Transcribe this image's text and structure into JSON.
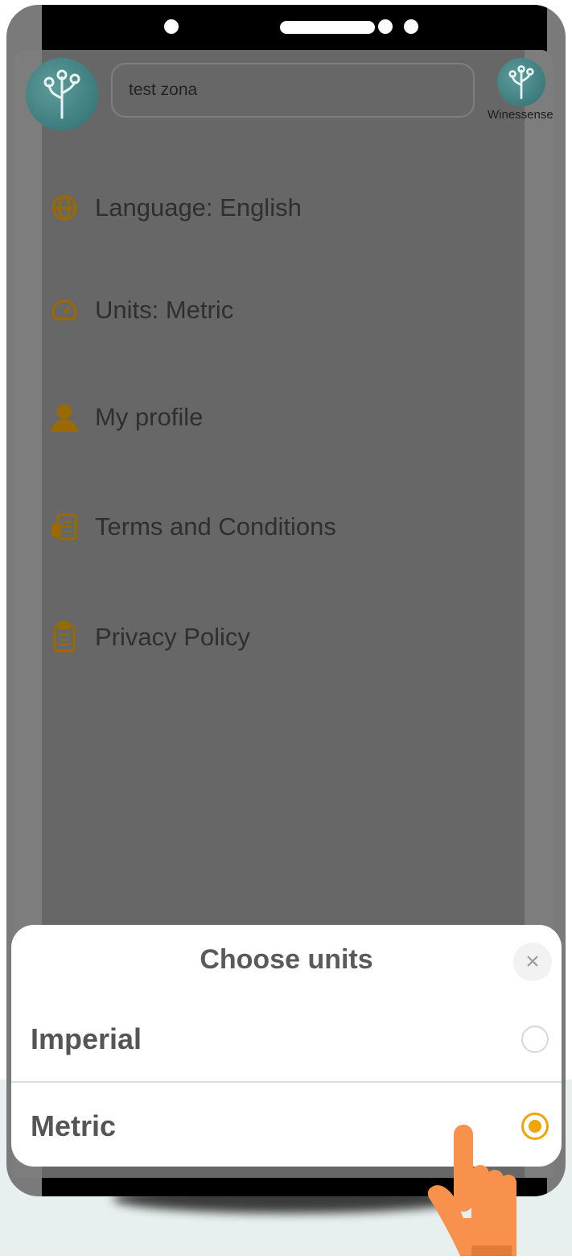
{
  "search": {
    "value": "test zona"
  },
  "brand": {
    "label": "Winessense"
  },
  "menu": {
    "items": [
      {
        "label": "Language: English",
        "icon": "globe-icon"
      },
      {
        "label": "Units: Metric",
        "icon": "gauge-icon"
      },
      {
        "label": "My profile",
        "icon": "person-icon"
      },
      {
        "label": "Terms and Conditions",
        "icon": "document-icon"
      },
      {
        "label": "Privacy Policy",
        "icon": "clipboard-icon"
      }
    ]
  },
  "sheet": {
    "title": "Choose units",
    "close_icon": "close-icon",
    "options": [
      {
        "label": "Imperial",
        "selected": false
      },
      {
        "label": "Metric",
        "selected": true
      }
    ]
  },
  "colors": {
    "accent": "#f2a500",
    "overlay": "#676767",
    "brand_teal": "#2d6f72",
    "pointer_hand": "#f7914b"
  }
}
